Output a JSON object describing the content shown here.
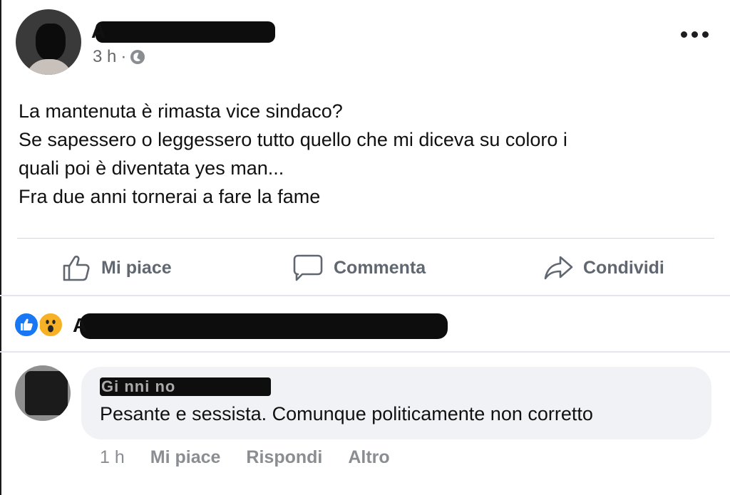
{
  "post": {
    "author_visible": "A",
    "timestamp": "3 h",
    "separator": "·",
    "text_lines": [
      "La mantenuta è rimasta vice sindaco?",
      "Se sapessero o leggessero tutto quello che mi diceva su coloro i",
      "quali poi è diventata yes man...",
      "Fra due anni tornerai a fare la fame"
    ]
  },
  "actions": {
    "like_label": "Mi piace",
    "comment_label": "Commenta",
    "share_label": "Condividi"
  },
  "reactions": {
    "types": [
      "like-icon",
      "wow-icon"
    ],
    "reactors_visible": "A",
    "colors": {
      "like": "#1877f2",
      "wow": "#f7b125"
    }
  },
  "comment": {
    "author_visible": "Gi   nni   no",
    "text": "Pesante e sessista. Comunque politicamente non corretto",
    "timestamp": "1 h",
    "like_label": "Mi piace",
    "reply_label": "Rispondi",
    "more_label": "Altro"
  }
}
